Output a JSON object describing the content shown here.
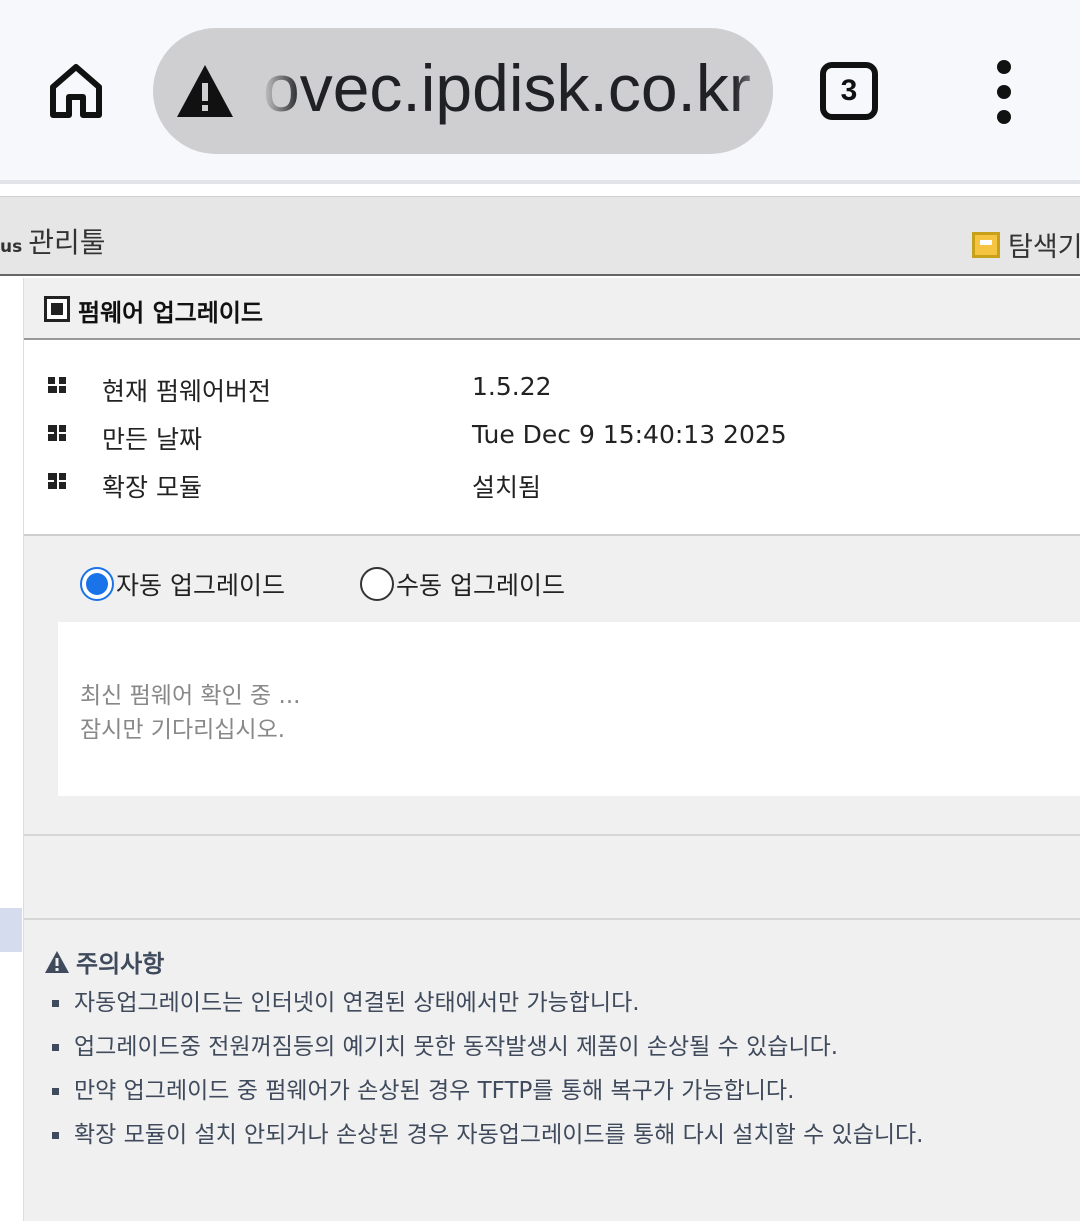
{
  "browser": {
    "url": "ovec.ipdisk.co.kr",
    "tab_count": "3",
    "icons": [
      "home-icon",
      "warning-icon",
      "tab-switcher-icon",
      "more-vert-icon"
    ]
  },
  "toolbar": {
    "brand_suffix": "us",
    "title": "관리툴",
    "explorer_label": "탐색기"
  },
  "section": {
    "title": "펌웨어 업그레이드"
  },
  "info": {
    "rows": [
      {
        "label": "현재 펌웨어버전",
        "value": "1.5.22"
      },
      {
        "label": "만든 날짜",
        "value": "Tue Dec 9 15:40:13 2025"
      },
      {
        "label": "확장 모듈",
        "value": "설치됨"
      }
    ]
  },
  "upgrade_mode": {
    "options": [
      {
        "label": "자동 업그레이드",
        "selected": true
      },
      {
        "label": "수동 업그레이드",
        "selected": false
      }
    ]
  },
  "status": {
    "line1": "최신 펌웨어 확인 중 ...",
    "line2": "잠시만 기다리십시오."
  },
  "notice": {
    "title": "주의사항",
    "items": [
      "자동업그레이드는 인터넷이 연결된 상태에서만 가능합니다.",
      "업그레이드중 전원꺼짐등의 예기치 못한 동작발생시 제품이 손상될 수 있습니다.",
      "만약 업그레이드 중 펌웨어가 손상된 경우 TFTP를 통해 복구가 가능합니다.",
      "확장 모듈이 설치 안되거나 손상된 경우 자동업그레이드를 통해 다시 설치할 수 있습니다."
    ]
  },
  "colors": {
    "accent": "#1a73e8",
    "notice_text": "#3f4a5c",
    "status_text": "#888888"
  }
}
